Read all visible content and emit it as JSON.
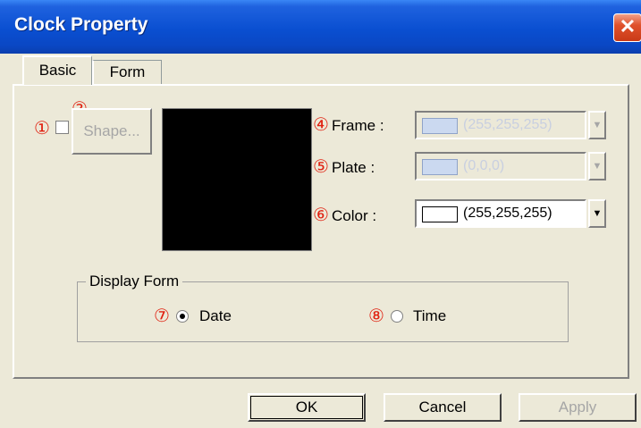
{
  "window": {
    "title": "Clock Property",
    "close_glyph": "✕"
  },
  "tabs": [
    {
      "label": "Basic",
      "active": true
    },
    {
      "label": "Form",
      "active": false
    }
  ],
  "markers": [
    "①",
    "②",
    "③",
    "④",
    "⑤",
    "⑥",
    "⑦",
    "⑧"
  ],
  "shape": {
    "label": "Shape...",
    "checked": false,
    "enabled": false
  },
  "colors": {
    "frame": {
      "label": "Frame :",
      "value": "(255,255,255)",
      "swatch": "#cbd9f0",
      "enabled": false
    },
    "plate": {
      "label": "Plate :",
      "value": "(0,0,0)",
      "swatch": "#cbd9f0",
      "enabled": false
    },
    "color": {
      "label": "Color :",
      "value": "(255,255,255)",
      "swatch": "#ffffff",
      "enabled": true
    },
    "preview": "#000000"
  },
  "display_form": {
    "title": "Display Form",
    "options": [
      {
        "label": "Date",
        "selected": true
      },
      {
        "label": "Time",
        "selected": false
      }
    ]
  },
  "buttons": {
    "ok": "OK",
    "cancel": "Cancel",
    "apply": "Apply",
    "dropdown_glyph": "▼"
  }
}
